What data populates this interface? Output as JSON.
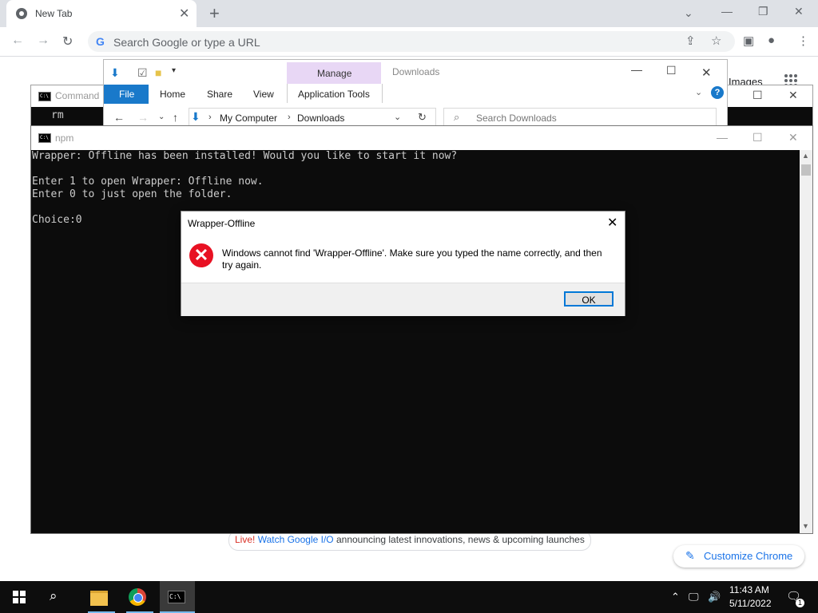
{
  "chrome": {
    "tab_title": "New Tab",
    "omnibox_placeholder": "Search Google or type a URL",
    "images_link": "Images",
    "banner_live": "Live!",
    "banner_watch": "Watch Google I/O",
    "banner_rest": "announcing latest innovations, news & upcoming launches",
    "customize_label": "Customize Chrome"
  },
  "explorer": {
    "manage_tab": "Manage",
    "window_title": "Downloads",
    "ribbon_tabs": [
      "File",
      "Home",
      "Share",
      "View",
      "Application Tools"
    ],
    "breadcrumb": [
      "My Computer",
      "Downloads"
    ],
    "search_placeholder": "Search Downloads"
  },
  "cmd_back": {
    "title": "Command",
    "line": "rm"
  },
  "npm_window": {
    "title": "npm",
    "console_lines": [
      "Wrapper: Offline has been installed! Would you like to start it now?",
      "",
      "Enter 1 to open Wrapper: Offline now.",
      "Enter 0 to just open the folder.",
      "",
      "Choice:0"
    ]
  },
  "dialog": {
    "title": "Wrapper-Offline",
    "message": "Windows cannot find 'Wrapper-Offline'. Make sure you typed the name correctly, and then try again.",
    "ok_label": "OK"
  },
  "taskbar": {
    "time": "11:43 AM",
    "date": "5/11/2022",
    "notification_count": "1"
  },
  "colors": {
    "dialog_error": "#e81123",
    "explorer_file_tab": "#1979ca",
    "manage_tab": "#e8d7f5",
    "chrome_accent": "#1a73e8"
  }
}
